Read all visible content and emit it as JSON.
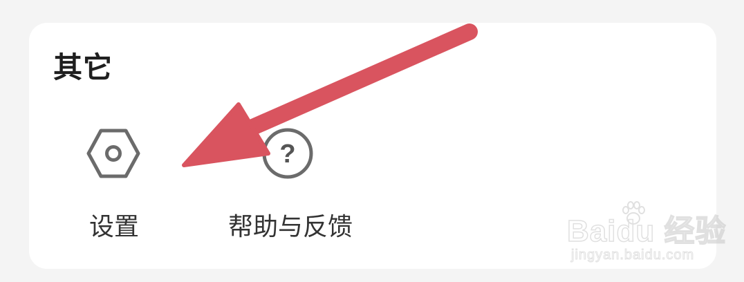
{
  "section": {
    "title": "其它"
  },
  "items": [
    {
      "label": "设置",
      "icon": "settings-hexagon-icon"
    },
    {
      "label": "帮助与反馈",
      "icon": "help-circle-icon",
      "icon_glyph": "?"
    }
  ],
  "overlay": {
    "arrow_color": "#d9545f"
  },
  "watermark": {
    "main": "Bai",
    "main_tail": "du 经验",
    "sub": "jingyan.baidu.com"
  },
  "colors": {
    "background": "#f4f4f4",
    "card": "#ffffff",
    "icon_stroke": "#6b6b6b",
    "text": "#333333"
  }
}
